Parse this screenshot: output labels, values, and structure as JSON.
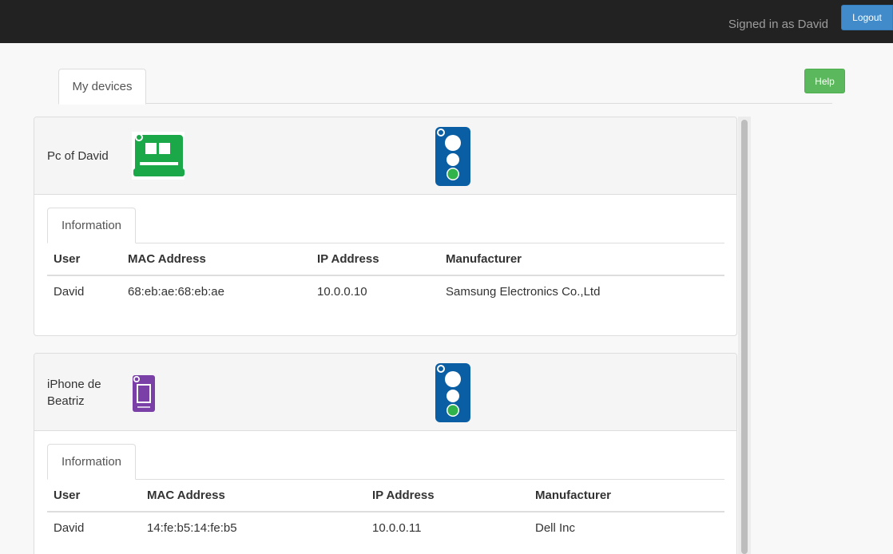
{
  "header": {
    "signed_in_text": "Signed in as David",
    "logout_label": "Logout"
  },
  "toolbar": {
    "help_label": "Help"
  },
  "tabs": {
    "main_tab_label": "My devices"
  },
  "columns": [
    "User",
    "MAC Address",
    "IP Address",
    "Manufacturer"
  ],
  "devices": [
    {
      "name": "Pc of David",
      "icon": "computer-icon",
      "icon_color": "#1aa849",
      "status": "traffic-light-green",
      "info_tab_label": "Information",
      "user": "David",
      "mac": "68:eb:ae:68:eb:ae",
      "ip": "10.0.0.10",
      "manufacturer": "Samsung Electronics Co.,Ltd"
    },
    {
      "name": "iPhone de Beatriz",
      "icon": "phone-icon",
      "icon_color": "#7b3fa8",
      "status": "traffic-light-green",
      "info_tab_label": "Information",
      "user": "David",
      "mac": "14:fe:b5:14:fe:b5",
      "ip": "10.0.0.11",
      "manufacturer": "Dell Inc"
    }
  ],
  "colors": {
    "topbar": "#222222",
    "logout": "#428bca",
    "help": "#5cb85c",
    "status_panel": "#0a5ea3",
    "status_green": "#2fb34a"
  }
}
